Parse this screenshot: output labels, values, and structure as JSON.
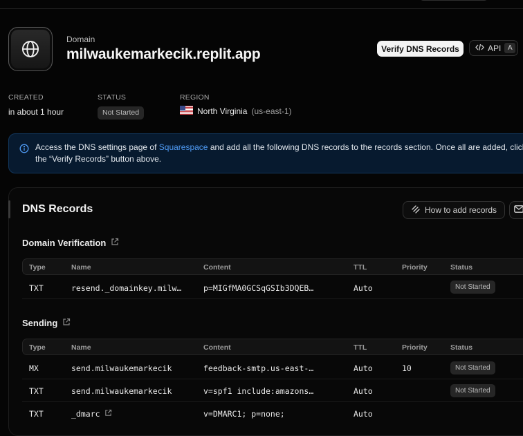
{
  "header": {
    "eyebrow": "Domain",
    "title": "milwaukemarkecik.replit.app",
    "verify_button": "Verify DNS Records",
    "api_button": "API",
    "api_shortcut": "A"
  },
  "meta": {
    "created_label": "CREATED",
    "created_value": "in about 1 hour",
    "status_label": "STATUS",
    "status_value": "Not Started",
    "region_label": "REGION",
    "region_name": "North Virginia",
    "region_code": "(us-east-1)"
  },
  "banner": {
    "text_before": "Access the DNS settings page of ",
    "link": "Squarespace",
    "text_after": " and add all the following DNS records to the records section. Once all are added, click",
    "line2": "the “Verify Records” button above."
  },
  "records": {
    "title": "DNS Records",
    "howto_button": "How to add records",
    "columns": [
      "Type",
      "Name",
      "Content",
      "TTL",
      "Priority",
      "Status"
    ],
    "domain_verification": {
      "title": "Domain Verification",
      "rows": [
        {
          "type": "TXT",
          "name": "resend._domainkey.milw…",
          "content": "p=MIGfMA0GCSqGSIb3DQEB…",
          "ttl": "Auto",
          "priority": "",
          "status": "Not Started"
        }
      ]
    },
    "sending": {
      "title": "Sending",
      "rows": [
        {
          "type": "MX",
          "name": "send.milwaukemarkecik",
          "content": "feedback-smtp.us-east-…",
          "ttl": "Auto",
          "priority": "10",
          "status": "Not Started"
        },
        {
          "type": "TXT",
          "name": "send.milwaukemarkecik",
          "content": "v=spf1 include:amazons…",
          "ttl": "Auto",
          "priority": "",
          "status": "Not Started"
        },
        {
          "type": "TXT",
          "name": "_dmarc",
          "content": "v=DMARC1; p=none;",
          "ttl": "Auto",
          "priority": "",
          "status": ""
        }
      ]
    }
  }
}
